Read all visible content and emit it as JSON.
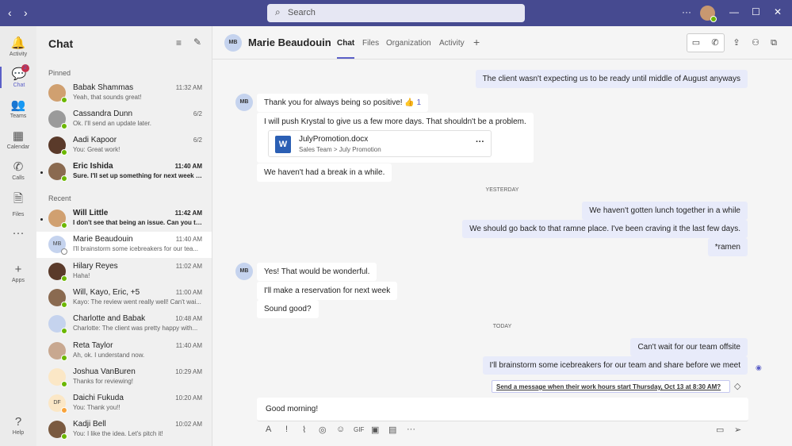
{
  "topbar": {
    "search_placeholder": "Search",
    "more": "···"
  },
  "rail": [
    {
      "label": "Activity",
      "icon": "bell-icon",
      "g": "🔔"
    },
    {
      "label": "Chat",
      "icon": "chat-icon",
      "g": "💬",
      "badge": "2"
    },
    {
      "label": "Teams",
      "icon": "teams-icon",
      "g": "👥"
    },
    {
      "label": "Calendar",
      "icon": "calendar-icon",
      "g": "▦"
    },
    {
      "label": "Calls",
      "icon": "phone-icon",
      "g": "✆"
    },
    {
      "label": "Files",
      "icon": "file-icon",
      "g": "🗎"
    },
    {
      "label": "",
      "icon": "more-icon",
      "g": "···"
    },
    {
      "label": "Apps",
      "icon": "plus-icon",
      "g": "+"
    },
    {
      "label": "Help",
      "icon": "help-icon",
      "g": "?"
    }
  ],
  "list": {
    "title": "Chat",
    "pinned_label": "Pinned",
    "recent_label": "Recent",
    "pinned": [
      {
        "name": "Babak Shammas",
        "time": "11:32 AM",
        "preview": "Yeah, that sounds great!"
      },
      {
        "name": "Cassandra Dunn",
        "time": "6/2",
        "preview": "Ok. I'll send an update later."
      },
      {
        "name": "Aadi Kapoor",
        "time": "6/2",
        "preview": "You: Great work!"
      },
      {
        "name": "Eric Ishida",
        "time": "11:40 AM",
        "preview": "Sure. I'll set up something for next week t...",
        "unread": true
      }
    ],
    "recent": [
      {
        "name": "Will Little",
        "time": "11:42 AM",
        "preview": "I don't see that being an issue. Can you ta...",
        "unread": true
      },
      {
        "name": "Marie Beaudouin",
        "time": "11:40 AM",
        "preview": "I'll brainstorm some icebreakers for our tea...",
        "initials": "MB",
        "selected": true
      },
      {
        "name": "Hilary Reyes",
        "time": "11:02 AM",
        "preview": "Haha!"
      },
      {
        "name": "Will, Kayo, Eric, +5",
        "time": "11:00 AM",
        "preview": "Kayo: The review went really well! Can't wai..."
      },
      {
        "name": "Charlotte and Babak",
        "time": "10:48 AM",
        "preview": "Charlotte: The client was pretty happy with..."
      },
      {
        "name": "Reta Taylor",
        "time": "11:40 AM",
        "preview": "Ah, ok. I understand now."
      },
      {
        "name": "Joshua VanBuren",
        "time": "10:29 AM",
        "preview": "Thanks for reviewing!"
      },
      {
        "name": "Daichi Fukuda",
        "time": "10:20 AM",
        "preview": "You: Thank you!!",
        "initials": "DF"
      },
      {
        "name": "Kadji Bell",
        "time": "10:02 AM",
        "preview": "You: I like the idea. Let's pitch it!"
      }
    ]
  },
  "header": {
    "initials": "MB",
    "name": "Marie Beaudouin",
    "tabs": [
      "Chat",
      "Files",
      "Organization",
      "Activity"
    ]
  },
  "messages": {
    "m1": "The client wasn't expecting us to be ready until middle of August anyways",
    "m2": "Thank you for always being so positive! 👍",
    "m2_reactions": "1",
    "m3": "I will push Krystal to give us a few more days. That shouldn't be a problem.",
    "file_name": "JulyPromotion.docx",
    "file_path": "Sales Team > July Promotion",
    "m4": "We haven't had a break in a while.",
    "day1": "YESTERDAY",
    "m5": "We haven't gotten lunch together in a while",
    "m6": "We should go back to that ramne place. I've been craving it the last few days.",
    "m7": "*ramen",
    "m8": "Yes! That would be wonderful.",
    "m9": "I'll make a reservation for next week",
    "m10": "Sound good?",
    "day2": "TODAY",
    "m11": "Can't wait for our team offsite",
    "m12": "I'll brainstorm some icebreakers for our team and share before we meet",
    "schedule": "Send a message when their work hours start Thursday, Oct 13 at 8:30 AM?"
  },
  "compose": {
    "value": "Good morning!"
  }
}
